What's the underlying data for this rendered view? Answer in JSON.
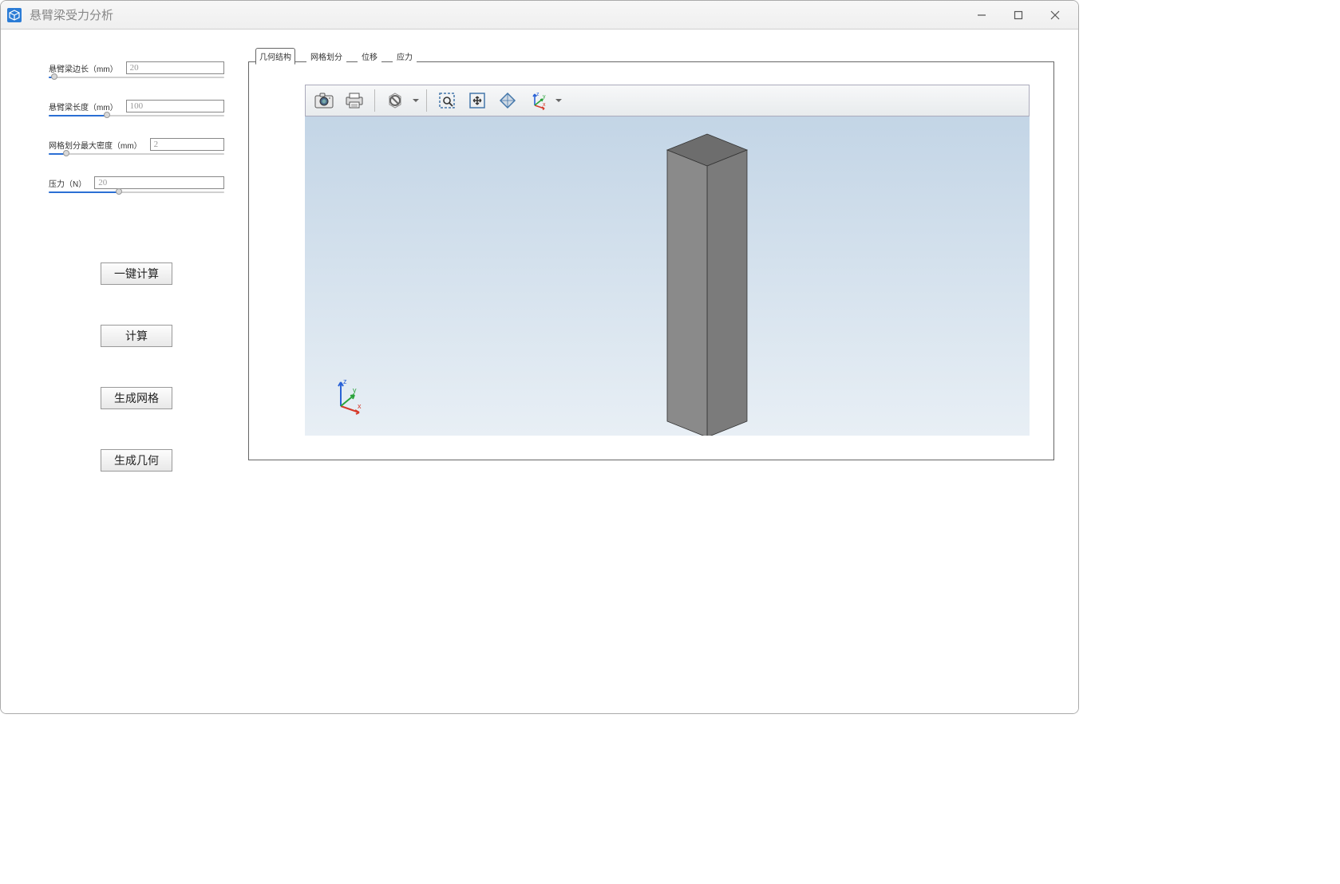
{
  "window": {
    "title": "悬臂梁受力分析"
  },
  "params": {
    "edge": {
      "label": "悬臂梁边长（mm）",
      "value": "20",
      "fill_pct": 3
    },
    "length": {
      "label": "悬臂梁长度（mm）",
      "value": "100",
      "fill_pct": 33
    },
    "mesh_density": {
      "label": "网格划分最大密度（mm）",
      "value": "2",
      "fill_pct": 10
    },
    "pressure": {
      "label": "压力（N）",
      "value": "20",
      "fill_pct": 40
    }
  },
  "buttons": {
    "one_click": "一键计算",
    "compute": "计算",
    "gen_mesh": "生成网格",
    "gen_geom": "生成几何"
  },
  "tabs": {
    "geometry": "几何结构",
    "mesh": "网格划分",
    "displacement": "位移",
    "stress": "应力"
  },
  "toolbar": {
    "snapshot": "snapshot",
    "print": "print",
    "filter": "filter",
    "zoom_box": "zoom-box",
    "extents": "extents",
    "transparency": "transparency",
    "axes": "axes"
  },
  "coord": {
    "x": "x",
    "y": "y",
    "z": "z"
  }
}
